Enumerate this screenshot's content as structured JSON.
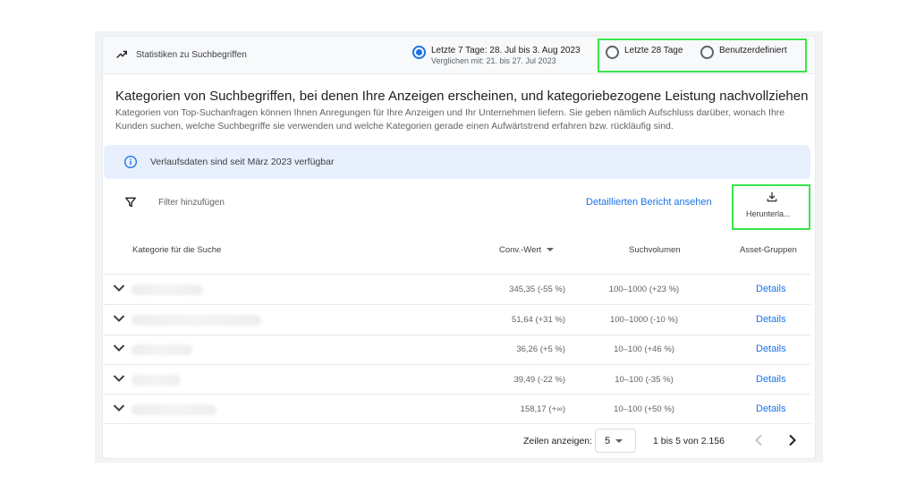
{
  "header": {
    "title": "Statistiken zu Suchbegriffen",
    "range_7": "Letzte 7 Tage: 28. Jul bis 3. Aug 2023",
    "range_7_compare": "Verglichen mit: 21. bis 27. Jul 2023",
    "range_28": "Letzte 28 Tage",
    "range_custom": "Benutzerdefiniert"
  },
  "main": {
    "title": "Kategorien von Suchbegriffen, bei denen Ihre Anzeigen erscheinen, und kategoriebezogene Leistung nachvollziehen",
    "description": "Kategorien von Top-Suchanfragen können Ihnen Anregungen für Ihre Anzeigen und Ihr Unternehmen liefern. Sie geben nämlich Aufschluss darüber, wonach Ihre Kunden suchen, welche Suchbegriffe sie verwenden und welche Kategorien gerade einen Aufwärtstrend erfahren bzw. rückläufig sind.",
    "info": "Verlaufsdaten sind seit März 2023 verfügbar"
  },
  "toolbar": {
    "filter_placeholder": "Filter hinzufügen",
    "detail_link": "Detaillierten Bericht ansehen",
    "download_label": "Herunterla..."
  },
  "table": {
    "columns": {
      "category": "Kategorie für die Suche",
      "conv": "Conv.-Wert",
      "volume": "Suchvolumen",
      "assets": "Asset-Gruppen"
    },
    "rows": [
      {
        "conv": "345,35 (-55 %)",
        "volume": "100–1000 (+23 %)",
        "details": "Details"
      },
      {
        "conv": "51,64 (+31 %)",
        "volume": "100–1000 (-10 %)",
        "details": "Details"
      },
      {
        "conv": "36,26 (+5 %)",
        "volume": "10–100 (+46 %)",
        "details": "Details"
      },
      {
        "conv": "39,49 (-22 %)",
        "volume": "10–100 (-35 %)",
        "details": "Details"
      },
      {
        "conv": "158,17 (+∞)",
        "volume": "10–100 (+50 %)",
        "details": "Details"
      }
    ]
  },
  "footer": {
    "rows_label": "Zeilen anzeigen:",
    "rows_value": "5",
    "range": "1 bis 5 von 2.156"
  },
  "colors": {
    "accent": "#1a73e8",
    "highlight": "#39e64b",
    "info_bg": "#e8f0fe"
  }
}
